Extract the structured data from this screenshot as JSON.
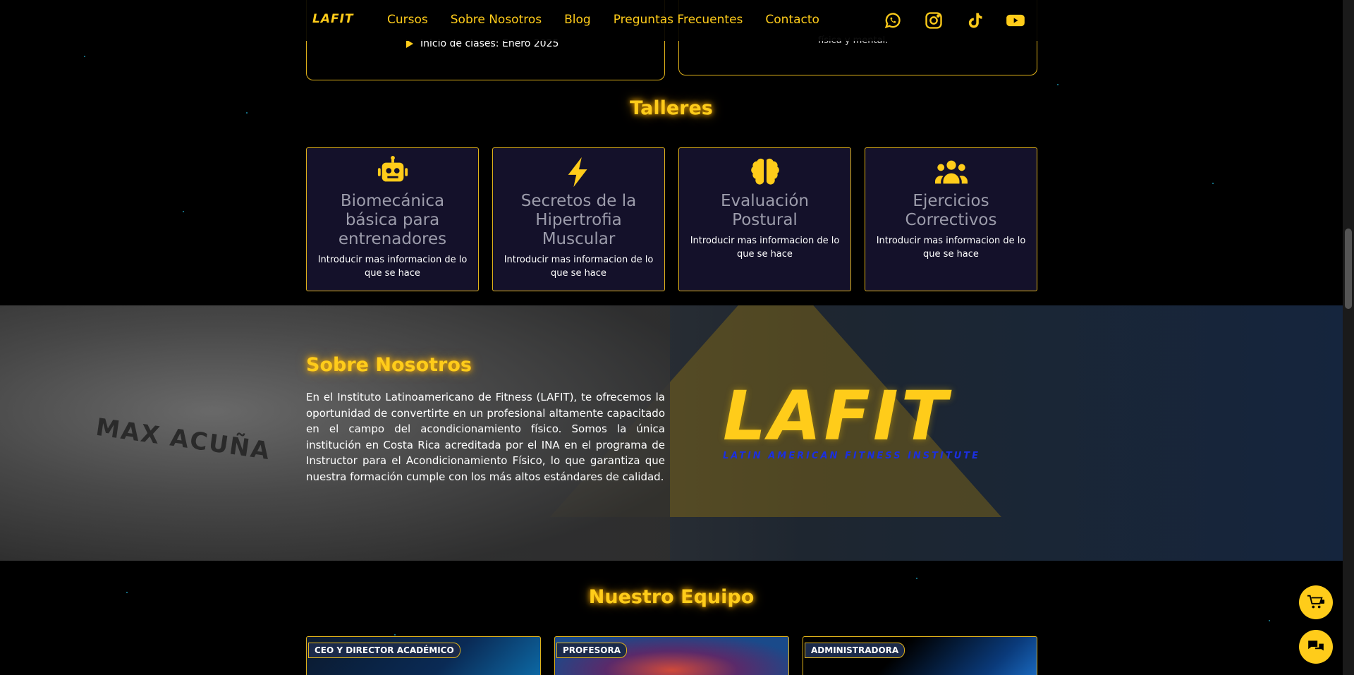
{
  "nav": {
    "logo": "LAFIT",
    "links": [
      "Cursos",
      "Sobre Nosotros",
      "Blog",
      "Preguntas Frecuentes",
      "Contacto"
    ]
  },
  "course_cards": {
    "start_date": "Inicio de clases: Enero 2025",
    "right_snippet": "física y mental."
  },
  "talleres": {
    "title": "Talleres",
    "items": [
      {
        "title": "Biomecánica básica para entrenadores",
        "desc": "Introducir mas informacion de lo que se hace",
        "icon": "robot-icon"
      },
      {
        "title": "Secretos de la Hipertrofia Muscular",
        "desc": "Introducir mas informacion de lo que se hace",
        "icon": "lightning-icon"
      },
      {
        "title": "Evaluación Postural",
        "desc": "Introducir mas informacion de lo que se hace",
        "icon": "brain-icon"
      },
      {
        "title": "Ejercicios Correctivos",
        "desc": "Introducir mas informacion de lo que se hace",
        "icon": "users-icon"
      }
    ]
  },
  "about": {
    "title": "Sobre Nosotros",
    "text": "En el Instituto Latinoamericano de Fitness (LAFIT), te ofrecemos la oportunidad de convertirte en un profesional altamente capacitado en el campo del acondicionamiento físico. Somos la única institución en Costa Rica acreditada por el INA en el programa de Instructor para el Acondicionamiento Físico, lo que garantiza que nuestra formación cumple con los más altos estándares de calidad.",
    "logo_word": "LAFIT",
    "logo_sub": "LATIN AMERICAN FITNESS INSTITUTE",
    "photo_text": "MAX ACUÑA"
  },
  "team": {
    "title": "Nuestro Equipo",
    "roles": [
      "CEO Y DIRECTOR ACADÉMICO",
      "PROFESORA",
      "ADMINISTRADORA"
    ]
  },
  "colors": {
    "accent": "#ffcc1a",
    "card_bg": "#14112a",
    "logo_sub": "#1b2fe0"
  }
}
